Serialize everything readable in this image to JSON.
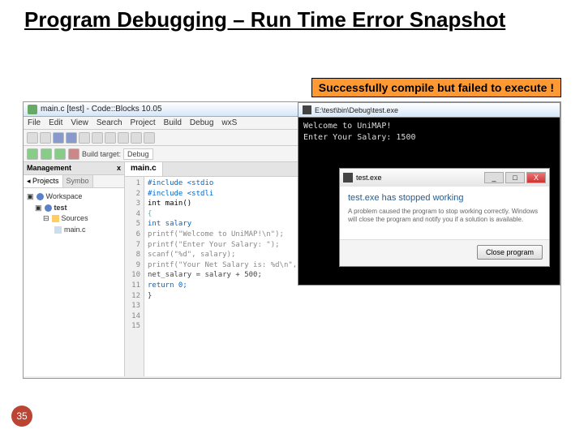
{
  "slide": {
    "title": "Program Debugging – Run Time Error Snapshot",
    "banner": "Successfully compile but failed to execute !",
    "page_number": "35"
  },
  "ide": {
    "window_title": "main.c [test] - Code::Blocks 10.05",
    "menus": [
      "File",
      "Edit",
      "View",
      "Search",
      "Project",
      "Build",
      "Debug",
      "wxS"
    ],
    "build_target_label": "Build target:",
    "build_target_value": "Debug",
    "management": {
      "title": "Management",
      "close": "x",
      "tabs": [
        "Projects",
        "Symbo"
      ],
      "tree": {
        "workspace": "Workspace",
        "project": "test",
        "sources": "Sources",
        "file": "main.c"
      }
    },
    "editor": {
      "tab": "main.c",
      "lines": [
        "1",
        "2",
        "3",
        "4",
        "5",
        "6",
        "7",
        "8",
        "9",
        "10",
        "11",
        "12",
        "13",
        "14",
        "15"
      ],
      "code": [
        "#include <stdio",
        "#include <stdli",
        "",
        "int main()",
        "{",
        "    int salary",
        "",
        "    printf(\"Welcome to UniMAP!\\n\");",
        "    printf(\"Enter Your Salary: \");",
        "    scanf(\"%d\", salary);",
        "    printf(\"Your Net Salary is: %d\\n\", net_salary);",
        "    net_salary = salary + 500;",
        "    return 0;",
        "}",
        ""
      ]
    }
  },
  "console": {
    "path": "E:\\test\\bin\\Debug\\test.exe",
    "line1": "Welcome to UniMAP!",
    "prompt": "Enter Your Salary:",
    "input": "1500"
  },
  "error_dialog": {
    "window_filename": "test.exe",
    "heading": "test.exe has stopped working",
    "body": "A problem caused the program to stop working correctly. Windows will close the program and notify you if a solution is available.",
    "button": "Close program",
    "win_min": "_",
    "win_max": "□",
    "win_close": "X"
  }
}
